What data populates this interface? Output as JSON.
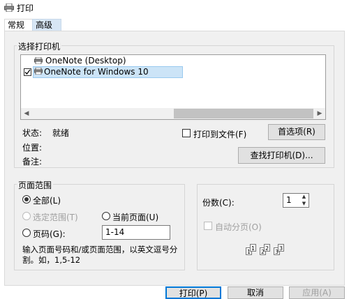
{
  "window": {
    "title": "打印"
  },
  "tabs": [
    {
      "label": "常规"
    },
    {
      "label": "高级"
    }
  ],
  "printer_group": {
    "title": "选择打印机",
    "printers": [
      {
        "name": "OneNote (Desktop)",
        "selected": false
      },
      {
        "name": "OneNote for Windows 10",
        "selected": true
      }
    ]
  },
  "status": {
    "status_label": "状态:",
    "status_value": "就绪",
    "location_label": "位置:",
    "comment_label": "备注:"
  },
  "print_to_file_label": "打印到文件(F)",
  "preferences_button": "首选项(R)",
  "find_printer_button": "查找打印机(D)...",
  "page_range": {
    "title": "页面范围",
    "all_label": "全部(L)",
    "selection_label": "选定范围(T)",
    "current_page_label": "当前页面(U)",
    "pages_label": "页码(G):",
    "pages_value": "1-14",
    "hint": "输入页面号码和/或页面范围，以英文逗号分割。如，1,5-12"
  },
  "copies": {
    "label": "份数(C):",
    "value": "1",
    "collate_label": "自动分页(O)"
  },
  "buttons": {
    "print": "打印(P)",
    "cancel": "取消",
    "apply": "应用(A)"
  }
}
